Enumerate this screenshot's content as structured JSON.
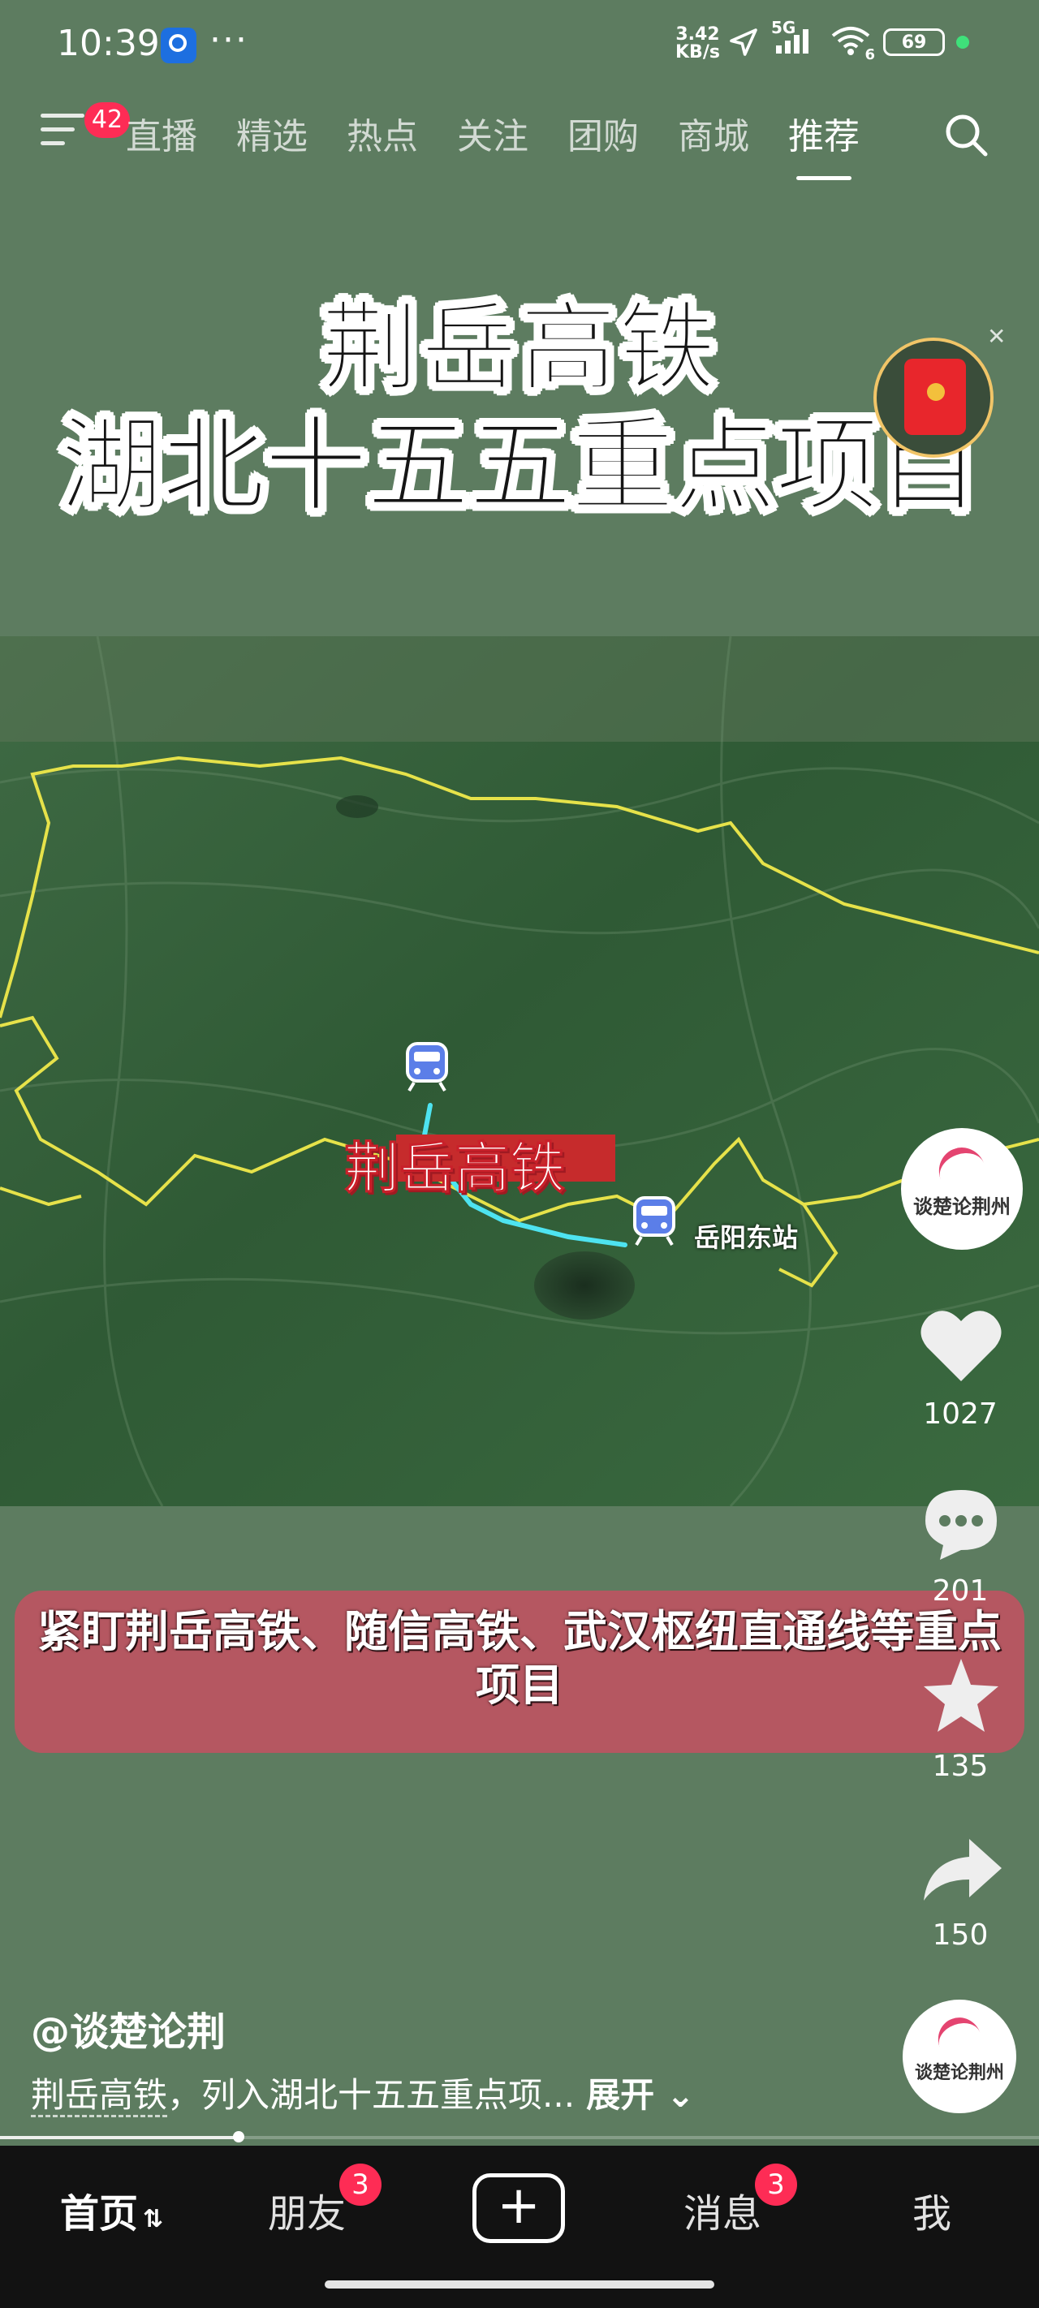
{
  "status_bar": {
    "time": "10:39",
    "dots": "···",
    "net_speed_value": "3.42",
    "net_speed_unit": "KB/s",
    "network": "5G",
    "wifi_sub": "6",
    "battery": "69"
  },
  "top_nav": {
    "menu_badge": "42",
    "tabs": [
      "直播",
      "精选",
      "热点",
      "关注",
      "团购",
      "商城",
      "推荐"
    ],
    "active_tab": "推荐"
  },
  "video": {
    "headline_line1": "荆岳高铁",
    "headline_line2": "湖北十五五重点项目",
    "map_route_label": "荆岳高铁",
    "map_station_label": "岳阳东站",
    "caption": "紧盯荆岳高铁、随信高铁、武汉枢纽直通线等重点项目"
  },
  "side_rail": {
    "avatar_text": "谈楚论荆州",
    "likes": "1027",
    "comments": "201",
    "favorites": "135",
    "shares": "150"
  },
  "info": {
    "author": "@谈楚论荆",
    "desc_link": "荆岳高铁",
    "desc_text": "，列入湖北十五五重点项...",
    "expand_label": "展开",
    "progress": 0.23
  },
  "bottom_nav": {
    "home": "首页",
    "friends": "朋友",
    "friends_badge": "3",
    "messages": "消息",
    "messages_badge": "3",
    "me": "我"
  },
  "colors": {
    "background": "#5d7c60",
    "caption_bg": "#b55761",
    "badge": "#fe2c55",
    "route": "#4ee3f0",
    "border": "#e6e24a"
  }
}
